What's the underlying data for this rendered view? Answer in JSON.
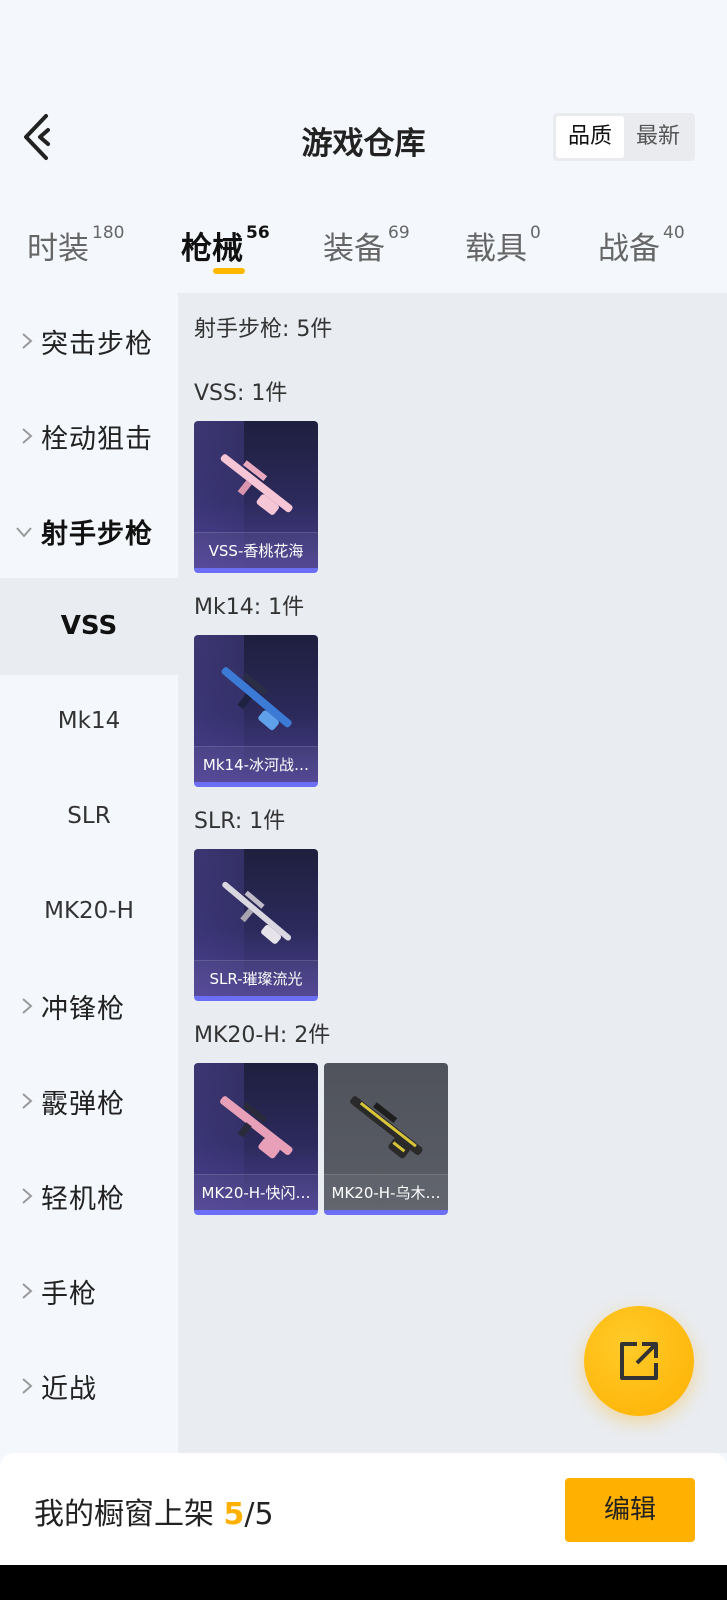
{
  "header": {
    "title": "游戏仓库",
    "sort_options": [
      "品质",
      "最新"
    ],
    "active_sort": "品质"
  },
  "tabs": [
    {
      "label": "时装",
      "count": "180"
    },
    {
      "label": "枪械",
      "count": "56"
    },
    {
      "label": "装备",
      "count": "69"
    },
    {
      "label": "载具",
      "count": "0"
    },
    {
      "label": "战备",
      "count": "40"
    }
  ],
  "active_tab": "枪械",
  "sidebar": {
    "items": [
      {
        "label": "突击步枪",
        "expanded": false
      },
      {
        "label": "栓动狙击",
        "expanded": false
      },
      {
        "label": "射手步枪",
        "expanded": true
      },
      {
        "label": "冲锋枪",
        "expanded": false
      },
      {
        "label": "霰弹枪",
        "expanded": false
      },
      {
        "label": "轻机枪",
        "expanded": false
      },
      {
        "label": "手枪",
        "expanded": false
      },
      {
        "label": "近战",
        "expanded": false
      }
    ],
    "subitems": [
      "VSS",
      "Mk14",
      "SLR",
      "MK20-H"
    ],
    "active_subitem": "VSS"
  },
  "content": {
    "summary": "射手步枪: 5件",
    "groups": [
      {
        "title": "VSS: 1件",
        "items": [
          {
            "name": "VSS-香桃花海",
            "color": "#f6c6d6"
          }
        ]
      },
      {
        "title": "Mk14: 1件",
        "items": [
          {
            "name": "Mk14-冰河战…",
            "color": "#3b7bd6"
          }
        ]
      },
      {
        "title": "SLR: 1件",
        "items": [
          {
            "name": "SLR-璀璨流光",
            "color": "#d9d7df"
          }
        ]
      },
      {
        "title": "MK20-H: 2件",
        "items": [
          {
            "name": "MK20-H-快闪…",
            "color": "#e7a0b7"
          },
          {
            "name": "MK20-H-乌木…",
            "color": "#d8c53a"
          }
        ]
      }
    ]
  },
  "bottom": {
    "showcase_label": "我的橱窗上架",
    "current": "5",
    "separator": "/",
    "total": "5",
    "edit_label": "编辑"
  },
  "colors": {
    "accent": "#ffb000",
    "card_border": "#6c6ff5"
  }
}
